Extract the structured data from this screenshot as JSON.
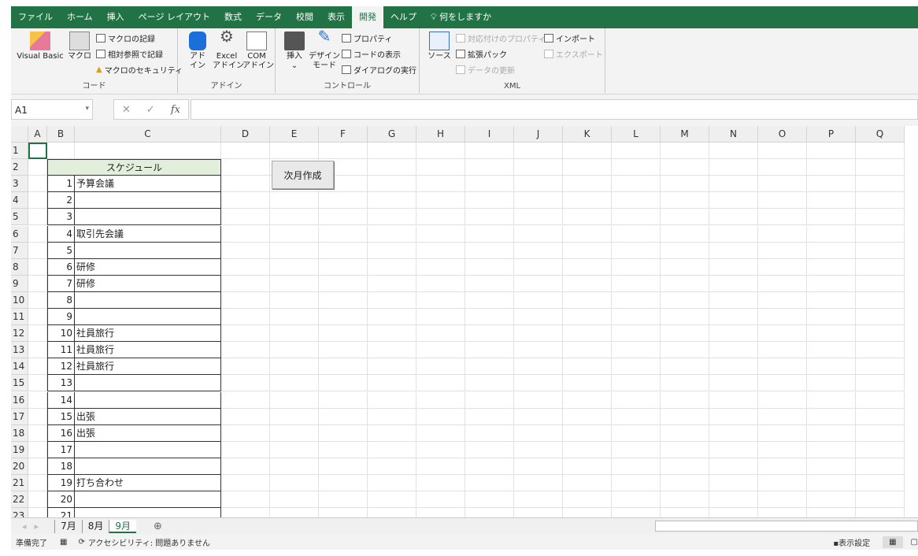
{
  "menu": {
    "tabs": [
      "ファイル",
      "ホーム",
      "挿入",
      "ページ レイアウト",
      "数式",
      "データ",
      "校閲",
      "表示",
      "開発",
      "ヘルプ"
    ],
    "active": "開発",
    "tell_me": "何をしますか"
  },
  "ribbon": {
    "code": {
      "label": "コード",
      "visual_basic": "Visual Basic",
      "macro": "マクロ",
      "record": "マクロの記録",
      "relative": "相対参照で記録",
      "security": "マクロのセキュリティ"
    },
    "addin": {
      "label": "アドイン",
      "addin": "アド\nイン",
      "excel_addin": "Excel\nアドイン",
      "com_addin": "COM\nアドイン"
    },
    "controls": {
      "label": "コントロール",
      "insert": "挿入",
      "design": "デザイン\nモード",
      "properties": "プロパティ",
      "view_code": "コードの表示",
      "run_dialog": "ダイアログの実行"
    },
    "xml": {
      "label": "XML",
      "source": "ソース",
      "map_props": "対応付けのプロパティ",
      "expansion": "拡張パック",
      "refresh": "データの更新",
      "import": "インポート",
      "export": "エクスポート"
    }
  },
  "formula_bar": {
    "name_box": "A1",
    "fx": "fx",
    "value": ""
  },
  "columns": [
    "A",
    "B",
    "C",
    "D",
    "E",
    "F",
    "G",
    "H",
    "I",
    "J",
    "K",
    "L",
    "M",
    "N",
    "O",
    "P",
    "Q"
  ],
  "rows": [
    "1",
    "2",
    "3",
    "4",
    "5",
    "6",
    "7",
    "8",
    "9",
    "10",
    "11",
    "12",
    "13",
    "14",
    "15",
    "16",
    "17",
    "18",
    "19",
    "20",
    "21",
    "22",
    "23"
  ],
  "table": {
    "header": "スケジュール",
    "days": [
      "1",
      "2",
      "3",
      "4",
      "5",
      "6",
      "7",
      "8",
      "9",
      "10",
      "11",
      "12",
      "13",
      "14",
      "15",
      "16",
      "17",
      "18",
      "19",
      "20",
      "21"
    ],
    "events": [
      "予算会議",
      "",
      "",
      "取引先会議",
      "",
      "研修",
      "研修",
      "",
      "",
      "社員旅行",
      "社員旅行",
      "社員旅行",
      "",
      "",
      "出張",
      "出張",
      "",
      "",
      "打ち合わせ",
      "",
      ""
    ]
  },
  "button": {
    "label": "次月作成"
  },
  "sheets": [
    "7月",
    "8月",
    "9月"
  ],
  "active_sheet": "9月",
  "status": {
    "ready": "準備完了",
    "accessibility": "アクセシビリティ: 問題ありません",
    "display_settings": "表示設定"
  },
  "colors": {
    "accent": "#217346",
    "header_fill": "#e2efda"
  }
}
